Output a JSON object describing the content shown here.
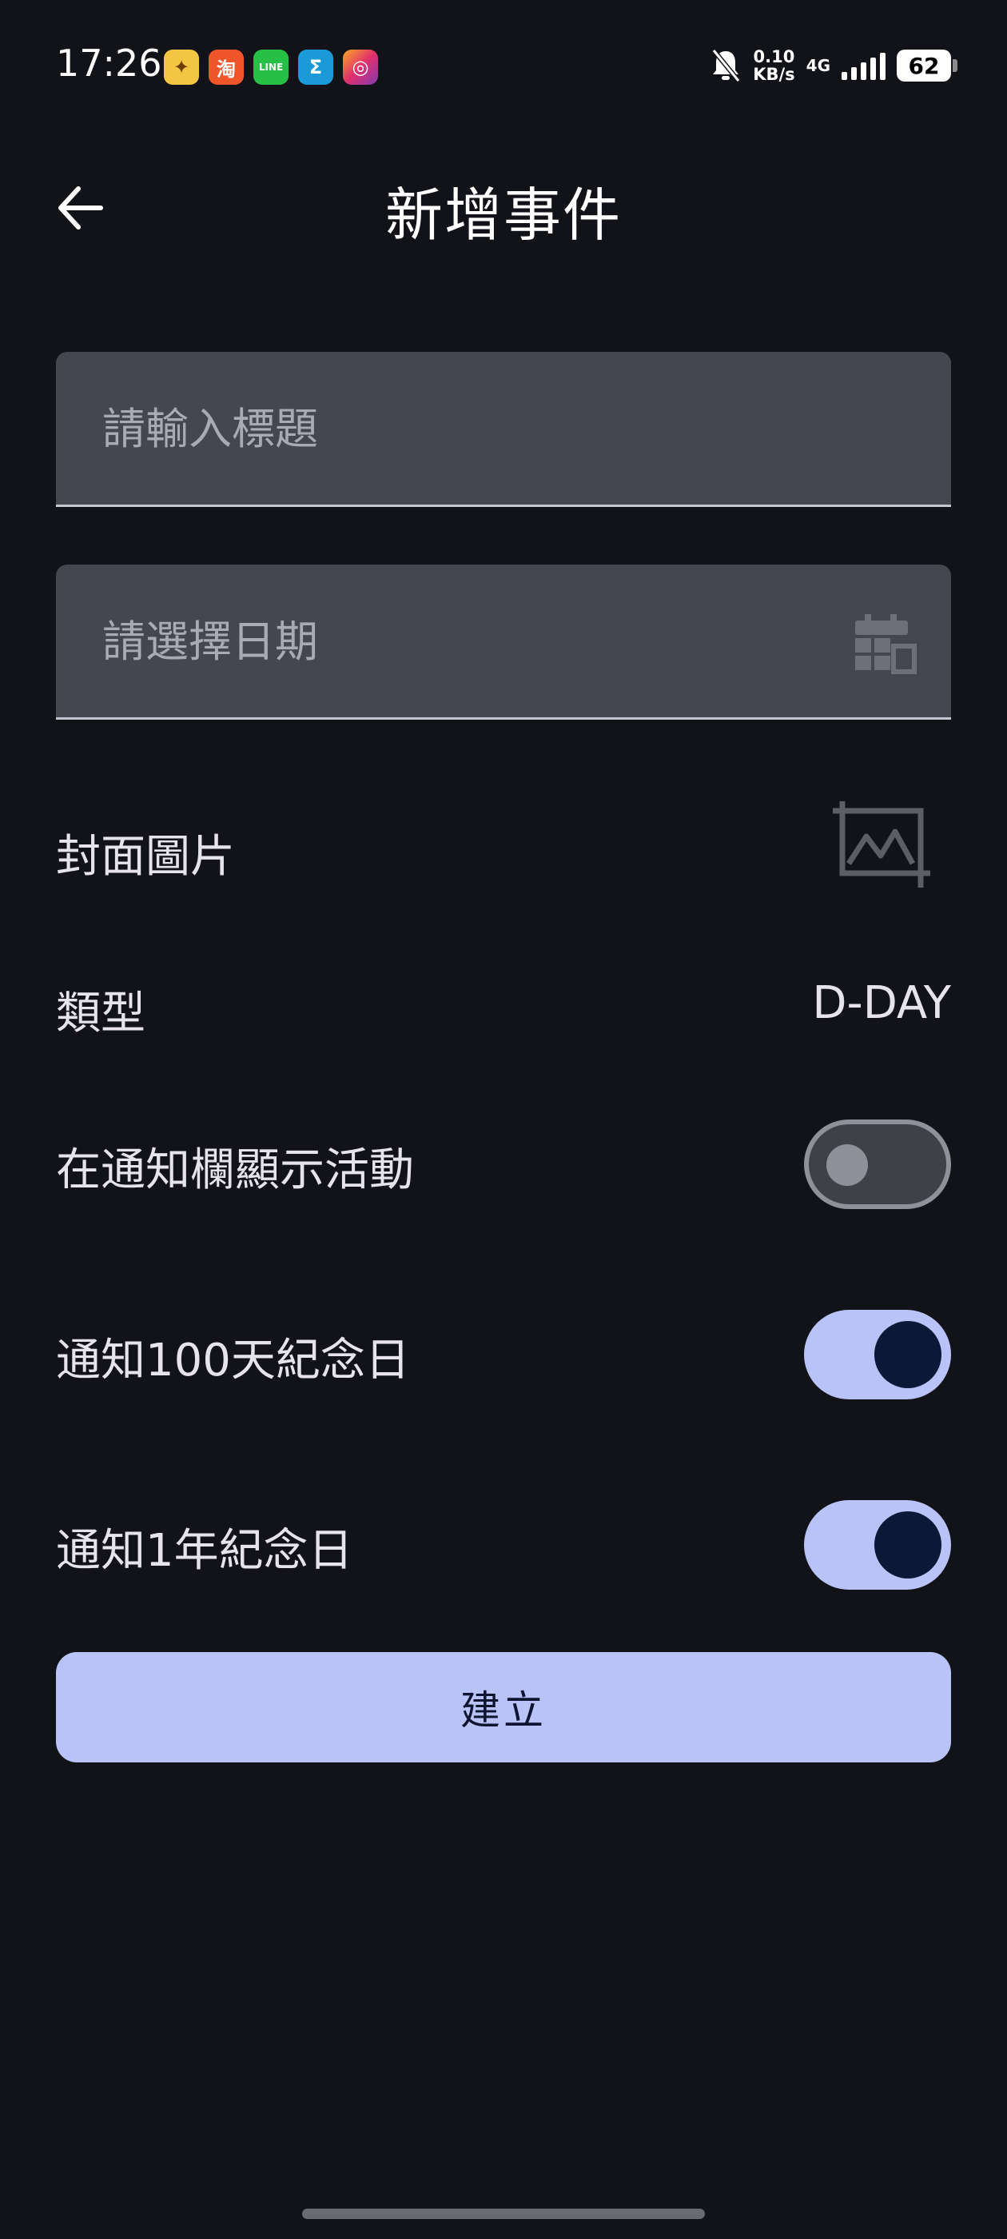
{
  "status_bar": {
    "time": "17:26",
    "speed_top": "0.10",
    "speed_bottom": "KB/s",
    "network": "4G",
    "battery": "62",
    "apps": [
      {
        "icon": "news-app-icon",
        "glyph": "✦",
        "color": "#f4c542"
      },
      {
        "icon": "taobao-icon",
        "glyph": "淘",
        "color": "#f0562a"
      },
      {
        "icon": "line-icon",
        "glyph": "LINE",
        "color": "#27c046"
      },
      {
        "icon": "sigma-app-icon",
        "glyph": "Σ",
        "color": "#1a9ad6"
      },
      {
        "icon": "instagram-icon",
        "glyph": "◎",
        "color": "#c13584"
      }
    ]
  },
  "app_bar": {
    "title": "新增事件"
  },
  "form": {
    "title_placeholder": "請輸入標題",
    "date_placeholder": "請選擇日期",
    "cover_label": "封面圖片",
    "type_label": "類型",
    "type_value": "D-DAY",
    "notify_bar_label": "在通知欄顯示活動",
    "notify_bar_on": false,
    "notify_100_label": "通知100天紀念日",
    "notify_100_on": true,
    "notify_year_label": "通知1年紀念日",
    "notify_year_on": true
  },
  "actions": {
    "create_label": "建立"
  },
  "colors": {
    "background": "#121318",
    "accent": "#bac3f7",
    "field": "#45464f"
  }
}
